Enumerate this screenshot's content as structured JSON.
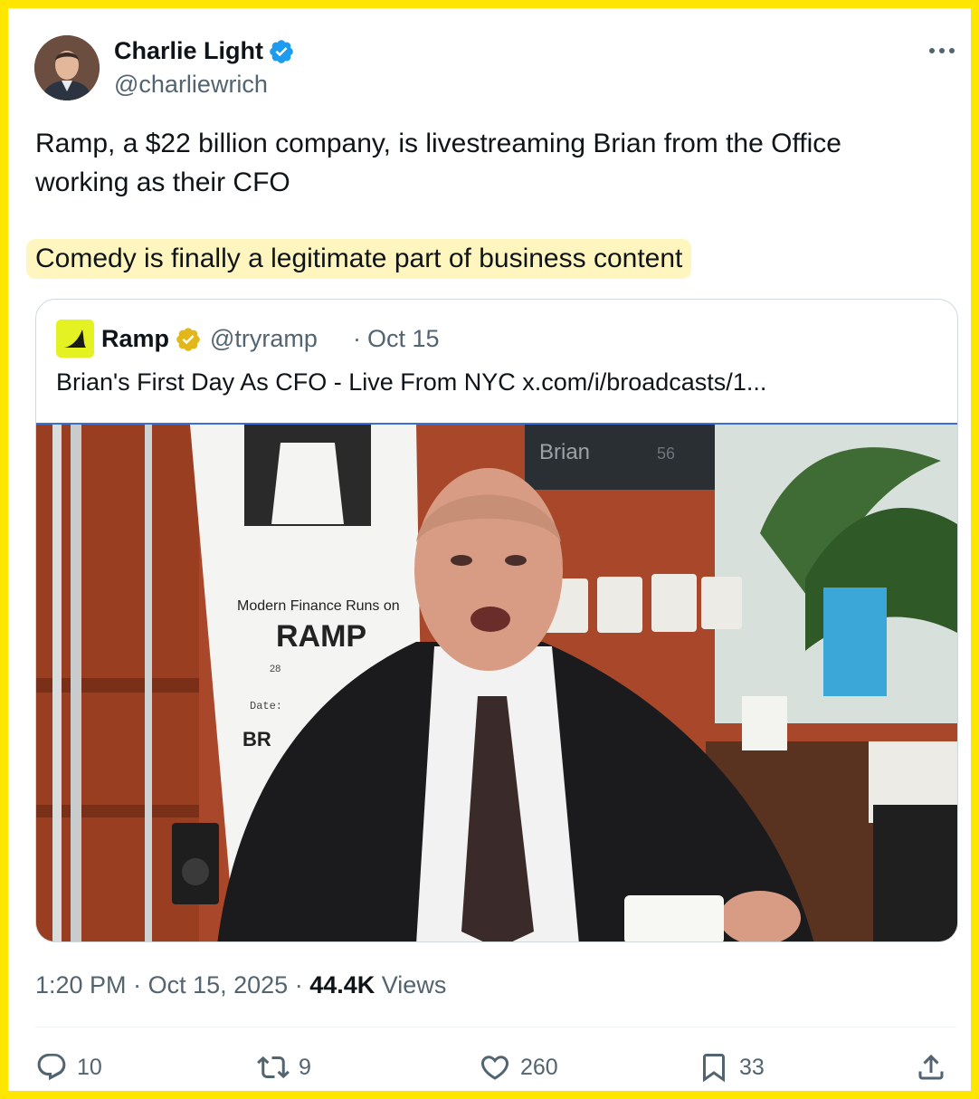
{
  "author": {
    "name": "Charlie Light",
    "handle": "@charliewrich"
  },
  "tweet": {
    "line1": "Ramp, a $22 billion company, is livestreaming Brian from the Office",
    "line2": "working as their CFO",
    "highlight": "Comedy is finally a legitimate part of business content"
  },
  "quote": {
    "name": "Ramp",
    "handle": "@tryramp",
    "separator": "·",
    "date": "Oct 15",
    "text": "Brian's First Day As CFO - Live From NYC x.com/i/broadcasts/1...",
    "poster_text": "Modern Finance Runs on",
    "poster_brand": "RAMP",
    "poster_num": "28",
    "poster_date_label": "Date:",
    "poster_bottom": "BR",
    "screen_label": "Brian",
    "screen_num": "56"
  },
  "meta": {
    "time": "1:20 PM",
    "date": "Oct 15, 2025",
    "views_count": "44.4K",
    "views_label": "Views"
  },
  "actions": {
    "replies": "10",
    "reposts": "9",
    "likes": "260",
    "bookmarks": "33"
  },
  "colors": {
    "frame": "#ffe600",
    "highlight": "#fff6bf",
    "verified_blue": "#1d9bf0",
    "verified_gold": "#e2b719",
    "ramp_yellow": "#e4f223"
  },
  "icons": [
    "verified-badge-icon",
    "more-icon",
    "reply-icon",
    "repost-icon",
    "like-icon",
    "bookmark-icon",
    "share-icon"
  ]
}
